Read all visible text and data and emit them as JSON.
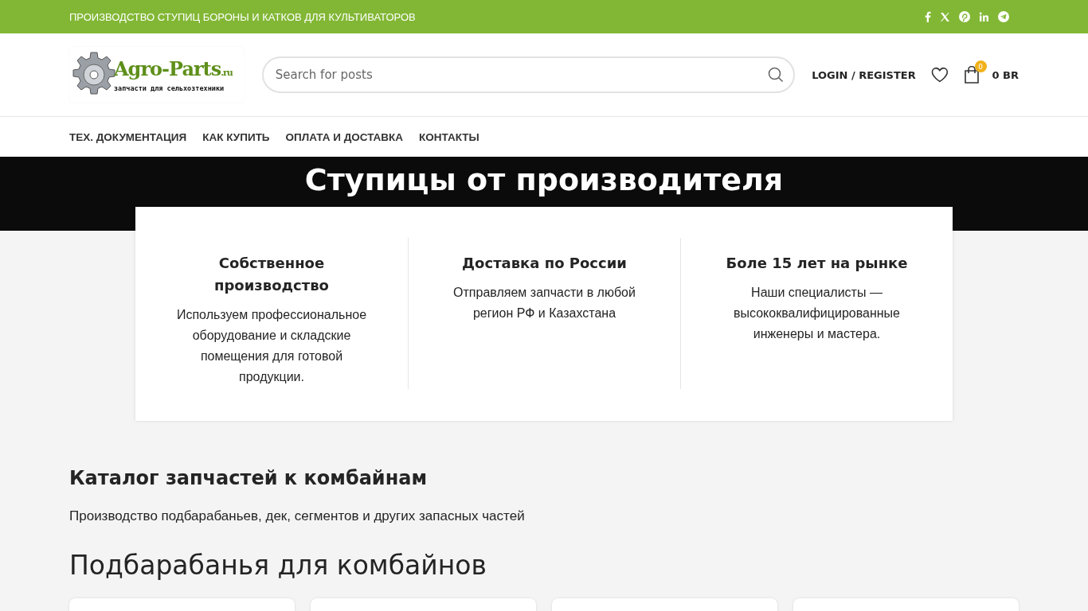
{
  "top_bar": {
    "text": "ПРОИЗВОДСТВО СТУПИЦ БОРОНЫ И КАТКОВ ДЛЯ КУЛЬТИВАТОРОВ",
    "social": [
      {
        "kind": "facebook"
      },
      {
        "kind": "x"
      },
      {
        "kind": "pinterest"
      },
      {
        "kind": "linkedin"
      },
      {
        "kind": "telegram"
      }
    ]
  },
  "header": {
    "logo": {
      "name": "Agro-Parts",
      "suffix": ".ru",
      "tagline": "запчасти для сельхозтехники"
    },
    "search": {
      "placeholder": "Search for posts"
    },
    "login": "LOGIN / REGISTER",
    "cart": {
      "count": "0",
      "total": "0 BR"
    }
  },
  "nav": [
    "ТЕХ. ДОКУМЕНТАЦИЯ",
    "КАК КУПИТЬ",
    "ОПЛАТА И ДОСТАВКА",
    "КОНТАКТЫ"
  ],
  "hero": {
    "title": "Ступицы от производителя"
  },
  "features": [
    {
      "title": "Собственное производство",
      "text": "Используем профессиональное оборудование и складские помещения для готовой продукции."
    },
    {
      "title": "Доставка по России",
      "text": "Отправляем запчасти в любой регион РФ и Казахстана"
    },
    {
      "title": "Боле 15 лет на рынке",
      "text": "Наши специалисты — высококвалифицированные инженеры и мастера."
    }
  ],
  "catalog": {
    "title": "Каталог запчастей к комбайнам",
    "text": "Производство подбарабаньев, дек, сегментов и других запасных частей"
  },
  "section": {
    "title": "Подбарабанья для комбайнов"
  }
}
